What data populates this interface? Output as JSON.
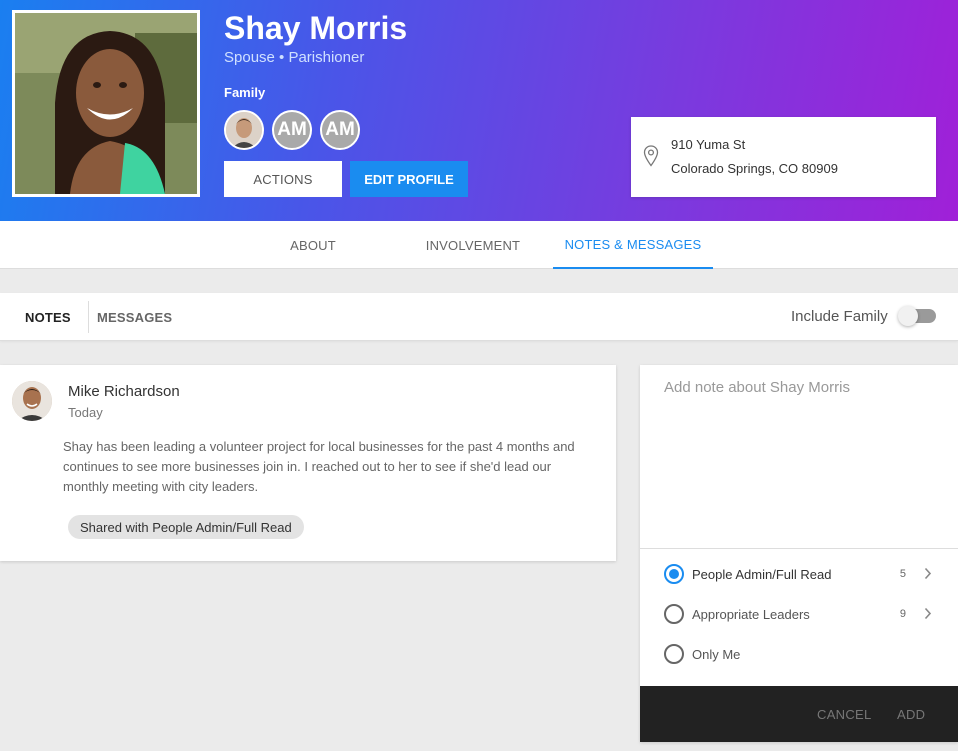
{
  "profile": {
    "name": "Shay Morris",
    "roles": "Spouse • Parishioner",
    "family_label": "Family",
    "family_members": [
      {
        "initials": ""
      },
      {
        "initials": "AM"
      },
      {
        "initials": "AM"
      }
    ],
    "actions_label": "ACTIONS",
    "edit_label": "EDIT PROFILE",
    "address_line1": "910 Yuma St",
    "address_line2": "Colorado Springs, CO 80909"
  },
  "main_tabs": [
    {
      "label": "ABOUT"
    },
    {
      "label": "INVOLVEMENT"
    },
    {
      "label": "NOTES & MESSAGES"
    }
  ],
  "sub_tabs": [
    {
      "label": "NOTES"
    },
    {
      "label": "MESSAGES"
    }
  ],
  "include_family_label": "Include Family",
  "note": {
    "author": "Mike Richardson",
    "date": "Today",
    "body": "Shay has been leading a volunteer project for local businesses for the past 4 months and continues to see more businesses join in. I reached out to her to see if she'd lead our monthly meeting with city leaders.",
    "shared": "Shared with People Admin/Full Read"
  },
  "add_note": {
    "placeholder": "Add note about Shay Morris",
    "options": [
      {
        "label": "People Admin/Full Read",
        "count": "5"
      },
      {
        "label": "Appropriate Leaders",
        "count": "9"
      },
      {
        "label": "Only Me",
        "count": ""
      }
    ],
    "cancel_label": "CANCEL",
    "add_label": "ADD"
  },
  "colors": {
    "accent": "#1a8cf0",
    "gradient_start": "#1a7ff0",
    "gradient_end": "#a020d8"
  }
}
